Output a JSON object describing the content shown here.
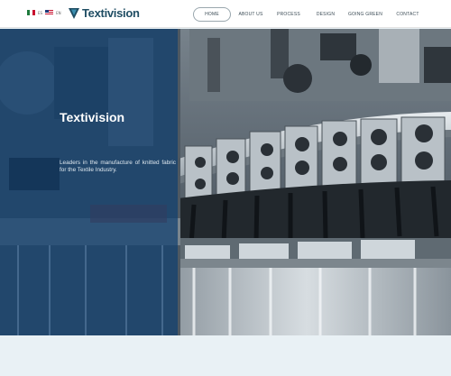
{
  "header": {
    "languages": [
      {
        "code": "ES",
        "flag": "mexico-flag-icon"
      },
      {
        "code": "EN",
        "flag": "usa-flag-icon"
      }
    ],
    "logo_text": "Textivision"
  },
  "nav": {
    "items": [
      {
        "label": "HOME",
        "active": true
      },
      {
        "label": "ABOUT US",
        "active": false
      },
      {
        "label": "PROCESS",
        "active": false
      },
      {
        "label": "DESIGN",
        "active": false
      },
      {
        "label": "GOING GREEN",
        "active": false
      },
      {
        "label": "CONTACT",
        "active": false
      }
    ]
  },
  "hero": {
    "title": "Textivision",
    "description": "Leaders in the manufacture of knitted fabric for the Textile Industry."
  },
  "colors": {
    "brand": "#1f4d63",
    "overlay": "#104070",
    "background": "#e9f1f5"
  }
}
